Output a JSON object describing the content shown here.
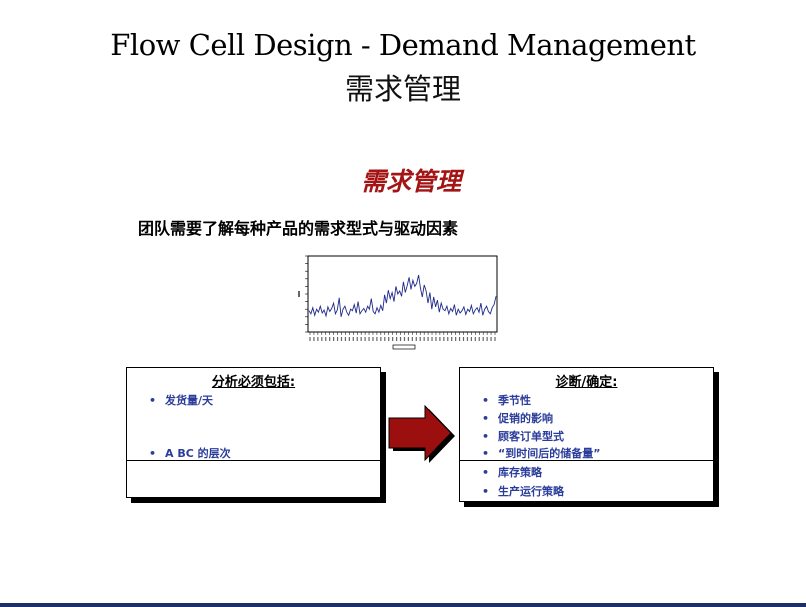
{
  "slide": {
    "title_en": "Flow Cell Design - Demand Management",
    "title_cn": "需求管理",
    "subtitle": "需求管理",
    "statement": "团队需要了解每种产品的需求型式与驱动因素"
  },
  "left_box": {
    "heading": "分析必须包括:",
    "items": [
      "发货量/天",
      "A BC 的层次"
    ]
  },
  "right_box": {
    "heading": "诊断/确定:",
    "items_top": [
      "季节性",
      "促销的影响",
      "顾客订单型式",
      "“到时间后的储备量”"
    ],
    "items_bottom": [
      "库存策略",
      "生产运行策略"
    ]
  },
  "colors": {
    "subtitle": "#a31414",
    "bullet_text": "#2b3d9a",
    "arrow_fill": "#9b0f0f",
    "series_line": "#1f2a8a"
  },
  "icons": {
    "arrow": "right-arrow-icon"
  },
  "chart_data": {
    "type": "line",
    "title": "",
    "xlabel": "",
    "ylabel": "",
    "ylim": [
      0,
      100
    ],
    "x": [
      1,
      2,
      3,
      4,
      5,
      6,
      7,
      8,
      9,
      10,
      11,
      12,
      13,
      14,
      15,
      16,
      17,
      18,
      19,
      20,
      21,
      22,
      23,
      24,
      25,
      26,
      27,
      28,
      29,
      30,
      31,
      32,
      33,
      34,
      35,
      36,
      37,
      38,
      39,
      40,
      41,
      42,
      43,
      44,
      45,
      46,
      47,
      48,
      49,
      50,
      51,
      52,
      53,
      54,
      55,
      56,
      57,
      58,
      59,
      60,
      61,
      62,
      63,
      64,
      65,
      66,
      67,
      68,
      69,
      70,
      71,
      72,
      73,
      74,
      75,
      76,
      77,
      78,
      79,
      80,
      81,
      82,
      83,
      84,
      85,
      86,
      87,
      88,
      89,
      90,
      91,
      92,
      93,
      94,
      95,
      96,
      97,
      98,
      99,
      100
    ],
    "series": [
      {
        "values": [
          28,
          24,
          32,
          22,
          30,
          26,
          34,
          25,
          29,
          21,
          33,
          27,
          31,
          38,
          24,
          29,
          45,
          20,
          30,
          34,
          26,
          22,
          30,
          28,
          36,
          25,
          40,
          24,
          28,
          31,
          26,
          34,
          30,
          44,
          27,
          24,
          32,
          26,
          35,
          28,
          49,
          38,
          55,
          44,
          52,
          40,
          60,
          50,
          54,
          47,
          66,
          52,
          61,
          72,
          56,
          68,
          60,
          64,
          75,
          58,
          46,
          62,
          54,
          38,
          52,
          30,
          46,
          33,
          42,
          26,
          38,
          30,
          28,
          34,
          24,
          31,
          27,
          36,
          22,
          30,
          25,
          28,
          33,
          23,
          30,
          27,
          35,
          24,
          29,
          32,
          26,
          38,
          22,
          30,
          34,
          27,
          24,
          32,
          36,
          47
        ]
      }
    ]
  }
}
